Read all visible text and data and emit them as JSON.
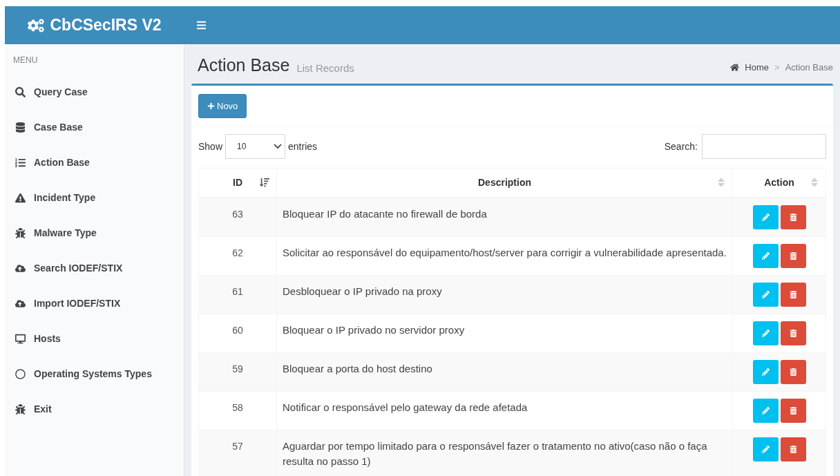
{
  "header": {
    "brand": "CbCSecIRS V2"
  },
  "sidebar": {
    "heading": "MENU",
    "items": [
      {
        "label": "Query Case",
        "kind": "search"
      },
      {
        "label": "Case Base",
        "kind": "database"
      },
      {
        "label": "Action Base",
        "kind": "list"
      },
      {
        "label": "Incident Type",
        "kind": "warning"
      },
      {
        "label": "Malware Type",
        "kind": "bug"
      },
      {
        "label": "Search IODEF/STIX",
        "kind": "cloud"
      },
      {
        "label": "Import IODEF/STIX",
        "kind": "cloud"
      },
      {
        "label": "Hosts",
        "kind": "desktop"
      },
      {
        "label": "Operating Systems Types",
        "kind": "circle"
      },
      {
        "label": "Exit",
        "kind": "bug"
      }
    ]
  },
  "page": {
    "title": "Action Base",
    "subtitle": "List Records",
    "breadcrumb": [
      "Home",
      "Action Base"
    ],
    "breadcrumb_separator": ">"
  },
  "new_button": "Novo",
  "length": {
    "before": "Show",
    "value": "10",
    "after": "entries"
  },
  "search": {
    "label": "Search:"
  },
  "table": {
    "columns": [
      {
        "label": "ID",
        "sorted": true
      },
      {
        "label": "Description",
        "sorted": false
      },
      {
        "label": "Action",
        "sorted": false
      }
    ],
    "rows": [
      {
        "id": "63",
        "description": "Bloquear IP do atacante no firewall de borda"
      },
      {
        "id": "62",
        "description": "Solicitar ao responsável do equipamento/host/server para corrigir a vulnerabilidade apresentada."
      },
      {
        "id": "61",
        "description": "Desbloquear o IP privado na proxy"
      },
      {
        "id": "60",
        "description": "Bloquear o IP privado no servidor proxy"
      },
      {
        "id": "59",
        "description": "Bloquear a porta do host destino"
      },
      {
        "id": "58",
        "description": "Notificar o responsável pelo gateway da rede afetada"
      },
      {
        "id": "57",
        "description": "Aguardar por tempo limitado para o responsável fazer o tratamento no ativo(caso não o faça resulta no passo 1)"
      }
    ]
  }
}
